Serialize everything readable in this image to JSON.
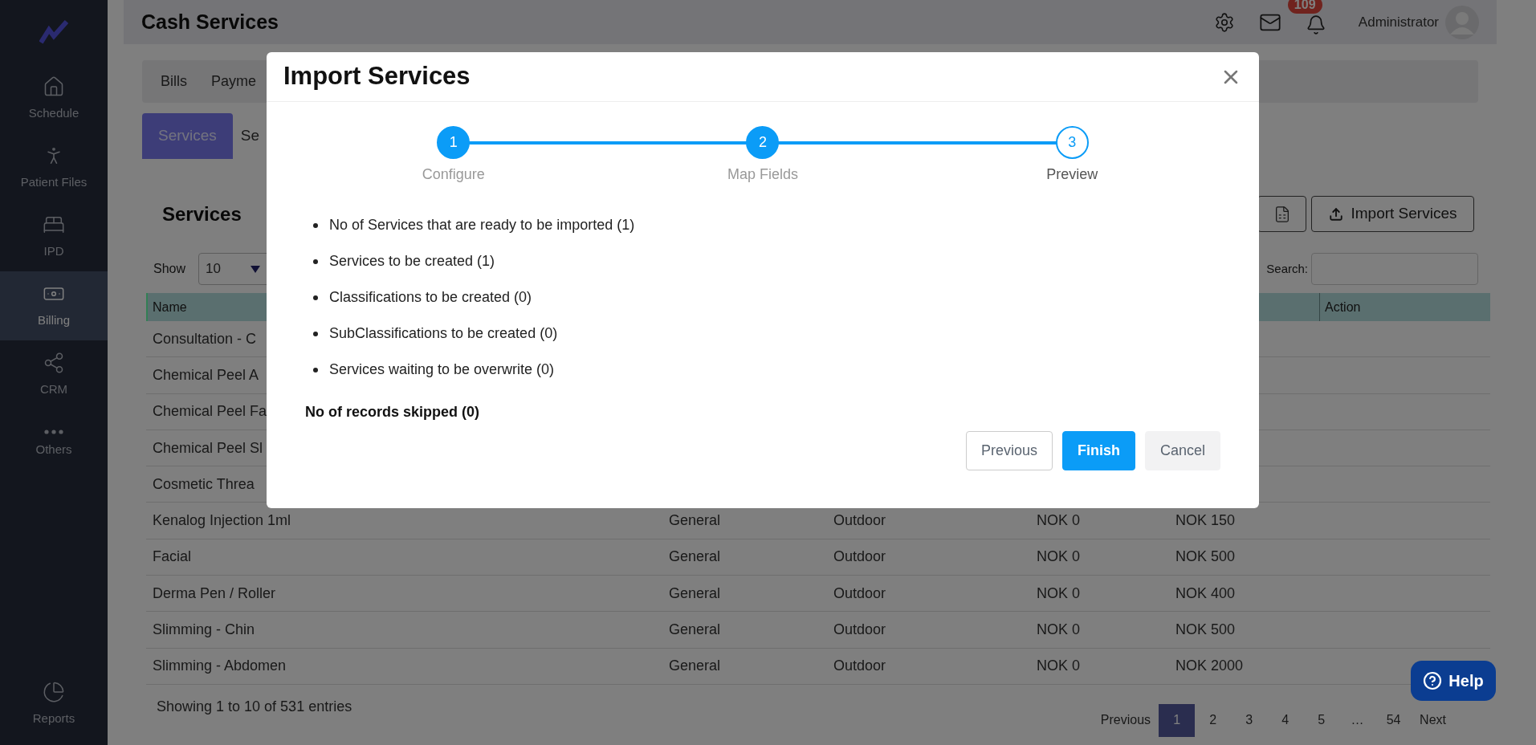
{
  "sidebar": {
    "items": [
      {
        "label": "Schedule",
        "selected": false
      },
      {
        "label": "Patient Files",
        "selected": false
      },
      {
        "label": "IPD",
        "selected": false
      },
      {
        "label": "Billing",
        "selected": true
      },
      {
        "label": "CRM",
        "selected": false
      },
      {
        "label": "Others",
        "selected": false
      }
    ],
    "bottom_item": {
      "label": "Reports",
      "selected": false
    }
  },
  "header": {
    "title": "Cash Services",
    "notifications": "109",
    "user": "Administrator"
  },
  "top_tabs": [
    {
      "label": "Bills",
      "selected": false
    },
    {
      "label": "Payme",
      "selected": false
    }
  ],
  "sub_tabs": [
    {
      "label": "Services",
      "selected": true
    },
    {
      "label": "Se",
      "selected": false
    }
  ],
  "card": {
    "title": "Services",
    "import_button": "Import Services",
    "show_label": "Show",
    "page_size": "10",
    "search_label": "Search:"
  },
  "table": {
    "columns": [
      {
        "label": "Name"
      },
      {
        "label": "Action"
      }
    ],
    "rows": [
      {
        "cells": [
          "Consultation - C"
        ]
      },
      {
        "cells": [
          "Chemical Peel A"
        ]
      },
      {
        "cells": [
          "Chemical Peel Fa"
        ]
      },
      {
        "cells": [
          "Chemical Peel Sl"
        ]
      },
      {
        "cells": [
          "Cosmetic Threa"
        ]
      },
      {
        "cells": [
          "Kenalog Injection 1ml",
          "General",
          "Outdoor",
          "NOK 0",
          "NOK 150"
        ]
      },
      {
        "cells": [
          "Facial",
          "General",
          "Outdoor",
          "NOK 0",
          "NOK 500"
        ]
      },
      {
        "cells": [
          "Derma Pen / Roller",
          "General",
          "Outdoor",
          "NOK 0",
          "NOK 400"
        ]
      },
      {
        "cells": [
          "Slimming - Chin",
          "General",
          "Outdoor",
          "NOK 0",
          "NOK 500"
        ]
      },
      {
        "cells": [
          "Slimming - Abdomen",
          "General",
          "Outdoor",
          "NOK 0",
          "NOK 2000"
        ]
      }
    ]
  },
  "footer": {
    "info": "Showing 1 to 10 of 531 entries",
    "pagination": [
      {
        "label": "Previous",
        "selected": false
      },
      {
        "label": "1",
        "selected": true
      },
      {
        "label": "2",
        "selected": false
      },
      {
        "label": "3",
        "selected": false
      },
      {
        "label": "4",
        "selected": false
      },
      {
        "label": "5",
        "selected": false
      },
      {
        "label": "…",
        "selected": false
      },
      {
        "label": "54",
        "selected": false
      },
      {
        "label": "Next",
        "selected": false
      }
    ]
  },
  "help": "Help",
  "modal": {
    "title": "Import Services",
    "steps": [
      {
        "number": "1",
        "label": "Configure",
        "completed": true
      },
      {
        "number": "2",
        "label": "Map Fields",
        "completed": true
      },
      {
        "number": "3",
        "label": "Preview",
        "completed": false
      }
    ],
    "summary": [
      "No of Services that are ready to be imported (1)",
      "Services to be created (1)",
      "Classifications to be created (0)",
      "SubClassifications to be created (0)",
      "Services waiting to be overwrite (0)"
    ],
    "skipped": "No of records skipped (0)",
    "buttons": [
      {
        "label": "Previous",
        "kind": "outline"
      },
      {
        "label": "Finish",
        "kind": "primary"
      },
      {
        "label": "Cancel",
        "kind": "light"
      }
    ]
  }
}
